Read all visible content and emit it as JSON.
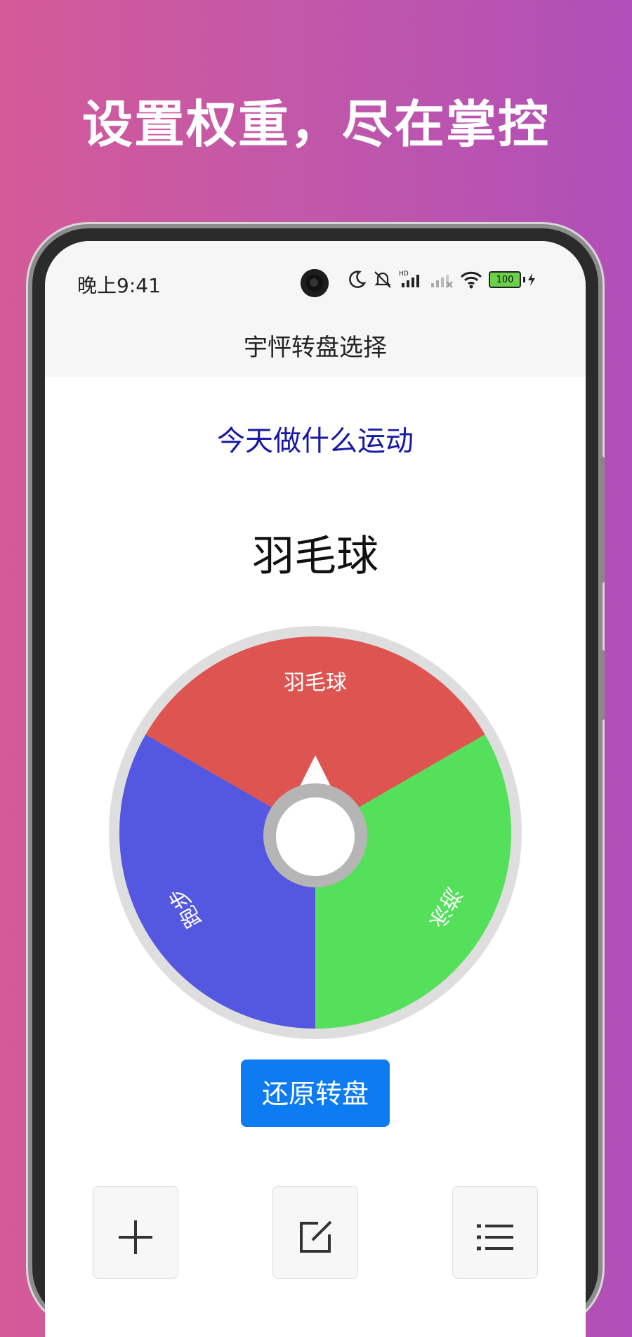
{
  "headline": "设置权重，尽在掌控",
  "status_bar": {
    "time": "晚上9:41",
    "battery": "100"
  },
  "app": {
    "title": "宇怦转盘选择"
  },
  "wheel": {
    "question": "今天做什么运动",
    "result": "羽毛球",
    "segments": [
      {
        "label": "羽毛球",
        "color": "#de5450",
        "weight": 1
      },
      {
        "label": "游泳",
        "color": "#54e05a",
        "weight": 1
      },
      {
        "label": "跑步",
        "color": "#5458e0",
        "weight": 1
      }
    ],
    "reset_label": "还原转盘"
  },
  "toolbar": {
    "items": [
      {
        "icon": "plus-icon"
      },
      {
        "icon": "edit-icon"
      },
      {
        "icon": "list-icon"
      }
    ]
  },
  "colors": {
    "accent": "#0d7cf2",
    "question_text": "#1717a8"
  }
}
